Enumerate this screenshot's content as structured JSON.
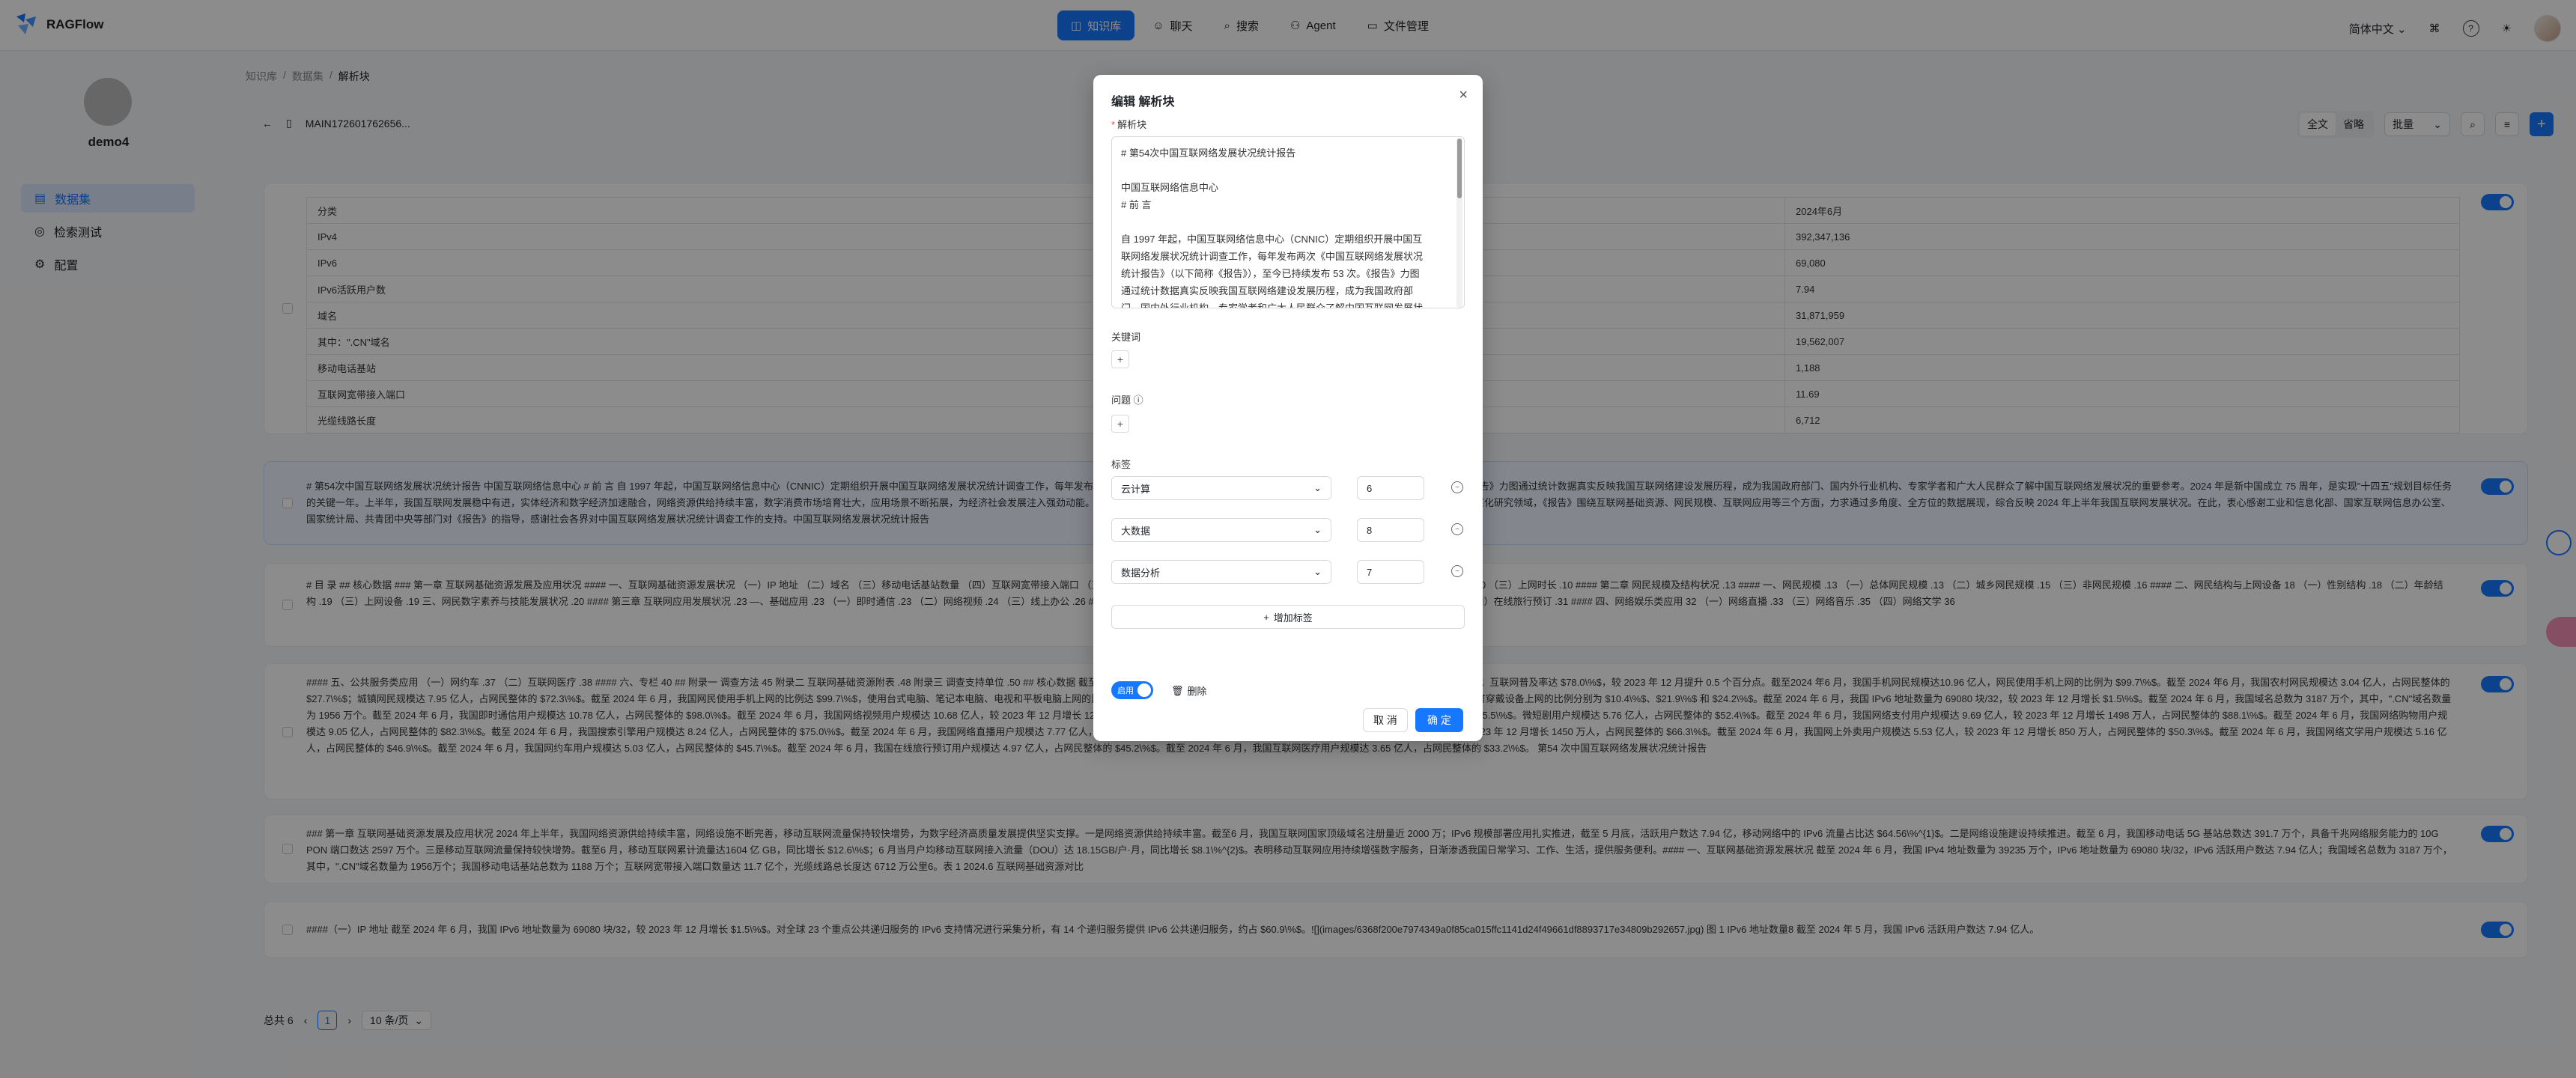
{
  "app": {
    "name": "RAGFlow"
  },
  "nav": {
    "items": [
      {
        "label": "知识库",
        "icon": "database-icon",
        "active": true
      },
      {
        "label": "聊天",
        "icon": "chat-icon",
        "active": false
      },
      {
        "label": "搜索",
        "icon": "search-icon",
        "active": false
      },
      {
        "label": "Agent",
        "icon": "agent-icon",
        "active": false
      },
      {
        "label": "文件管理",
        "icon": "folder-icon",
        "active": false
      }
    ],
    "language": "简体中文"
  },
  "sidebar": {
    "kb_name": "demo4",
    "items": [
      {
        "label": "数据集",
        "icon": "dataset-icon",
        "active": true
      },
      {
        "label": "检索测试",
        "icon": "retrieval-icon",
        "active": false
      },
      {
        "label": "配置",
        "icon": "gear-icon",
        "active": false
      }
    ]
  },
  "breadcrumb": [
    "知识库",
    "数据集",
    "解析块"
  ],
  "file": {
    "name": "MAIN172601762656..."
  },
  "toolbar": {
    "view_full": "全文",
    "view_brief": "省略",
    "batch": "批量"
  },
  "table": {
    "rows": [
      [
        "分类",
        "2024年6月"
      ],
      [
        "IPv4",
        "392,347,136"
      ],
      [
        "IPv6",
        "69,080"
      ],
      [
        "IPv6活跃用户数",
        "7.94"
      ],
      [
        "域名",
        "31,871,959"
      ],
      [
        "其中：\".CN\"域名",
        "19,562,007"
      ],
      [
        "移动电话基站",
        "1,188"
      ],
      [
        "互联网宽带接入端口",
        "11.69"
      ],
      [
        "光缆线路长度",
        "6,712"
      ]
    ]
  },
  "chunks": [
    "# 第54次中国互联网络发展状况统计报告 中国互联网络信息中心 # 前 言 自 1997 年起，中国互联网络信息中心（CNNIC）定期组织开展中国互联网络发展状况统计调查工作，每年发布两次《中国互联网络发展状况统计报告》（以下简称《报告》），至今已持续发布 53 次。《报告》力图通过统计数据真实反映我国互联网络建设发展历程，成为我国政府部门、国内外行业机构、专家学者和广大人民群众了解中国互联网络发展状况的重要参考。2024 年是新中国成立 75 周年，是实现\"十四五\"规划目标任务的关键一年。上半年，我国互联网发展稳中有进，实体经济和数字经济加速融合，网络资源供给持续丰富，数字消费市场培育壮大，应用场景不断拓展，为经济社会发展注入强劲动能。我国互联网络发展状况统计调查工作持续推进我国互联网发展历程，不断扩大研究范围，深化研究领域，《报告》围绕互联网基础资源、网民规模、互联网应用等三个方面，力求通过多角度、全方位的数据展现，综合反映 2024 年上半年我国互联网发展状况。在此，衷心感谢工业和信息化部、国家互联网信息办公室、国家统计局、共青团中央等部门对《报告》的指导，感谢社会各界对中国互联网络发展状况统计调查工作的支持。中国互联网络发展状况统计报告",
    "# 目 录 ## 核心数据 ### 第一章 互联网基础资源发展及应用状况 #### 一、互联网基础资源发展状况 （一）IP 地址 （二）域名 （三）移动电话基站数量 （四）互联网宽带接入端口 （五）光缆线路长度 ..... 二、IPv6 发展状况 ..... （一）网址 .. 9 （二）移动互联网接入流量 10 （三）上网时长 .10 #### 第二章 网民规模及结构状况 .13 #### 一、网民规模 .13 （一）总体网民规模 .13 （二）城乡网民规模 .15 （三）非网民规模 .16 #### 二、网民结构与上网设备 18 （一）性别结构 .18 （二）年龄结构 .19 （三）上网设备 .19 三、网民数字素养与技能发展状况 .20 #### 第三章 互联网应用发展状况 .23 —、基础应用 .23 （一）即时通信 .23 （二）网络视频 .24 （三）线上办公 .26 #### 三、商务交易类应用 （一）网络支付 .27 （二）网络购物 .28 （三）网上外卖 .29 （四）在线旅行预订 .31 #### 四、网络娱乐类应用 32 （一）网络直播 .33 （三）网络音乐 .35 （四）网络文学 36",
    "#### 五、公共服务类应用 （一）网约车 .37 （二）互联网医疗 .38 #### 六、专栏 40 ## 附录一 调查方法 45 附录二 互联网基础资源附表 .48 附录三 调查支持单位 .50 ## 核心数据 截至 2024 年 6 月，我国网民规模近 11 亿人（10.9967 亿人），较 2023 年 12 月增长 742万人；互联网普及率达 $78.0\\%$，较 2023 年 12 月提升 0.5 个百分点。截至2024 年6 月，我国手机网民规模达10.96 亿人，网民使用手机上网的比例为 $99.7\\%$。截至 2024 年6 月，我国农村网民规模达 3.04 亿人，占网民整体的 $27.7\\%$；城镇网民规模达 7.95 亿人，占网民整体的 $72.3\\%$。截至 2024 年 6 月，我国网民使用手机上网的比例达 $99.7\\%$，使用台式电脑、笔记本电脑、电视和平板电脑上网的比例分别为 $32.4\\%$、$25.2\\%$ 和 $30.5\\%$；使用智能网联汽车、智能家居设备和个人可穿戴设备上网的比例分别为 $10.4\\%$、$21.9\\%$ 和 $24.2\\%$。截至 2024 年 6 月，我国 IPv6 地址数量为 69080 块/32，较 2023 年 12 月增长 $1.5\\%$。截至 2024 年 6 月，我国域名总数为 3187 万个，其中，\".CN\"域名数量为 1956 万个。截至 2024 年 6 月，我国即时通信用户规模达 10.78 亿人，占网民整体的 $98.0\\%$。截至 2024 年 6 月，我国网络视频用户规模达 10.68 亿人，较 2023 年 12 月增长 125 万人，占网民整体的 $97.1\\%$，其中，短视频用户规模达 10.50 亿人，占网民整体的 $95.5\\%$。微短剧用户规模达 5.76 亿人，占网民整体的 $52.4\\%$。截至 2024 年 6 月，我国网络支付用户规模达 9.69 亿人，较 2023 年 12 月增长 1498 万人，占网民整体的 $88.1\\%$。截至 2024 年 6 月，我国网络购物用户规模达 9.05 亿人，占网民整体的 $82.3\\%$。截至 2024 年 6 月，我国搜索引擎用户规模达 8.24 亿人，占网民整体的 $75.0\\%$。截至 2024 年 6 月，我国网络直播用户规模达 7.77 亿人，占网民整体的 $70.6\\%$。截至 2024 年 6 月，我国网络音乐用户规模达 7.29 亿人，较 2023 年 12 月增长 1450 万人，占网民整体的 $66.3\\%$。截至 2024 年 6 月，我国网上外卖用户规模达 5.53 亿人，较 2023 年 12 月增长 850 万人，占网民整体的 $50.3\\%$。截至 2024 年 6 月，我国网络文学用户规模达 5.16 亿人，占网民整体的 $46.9\\%$。截至 2024 年 6 月，我国网约车用户规模达 5.03 亿人，占网民整体的 $45.7\\%$。截至 2024 年 6 月，我国在线旅行预订用户规模达 4.97 亿人，占网民整体的 $45.2\\%$。截至 2024 年 6 月，我国互联网医疗用户规模达 3.65 亿人，占网民整体的 $33.2\\%$。 第54 次中国互联网络发展状况统计报告",
    "### 第一章 互联网基础资源发展及应用状况 2024 年上半年，我国网络资源供给持续丰富，网络设施不断完善，移动互联网流量保持较快增势，为数字经济高质量发展提供坚实支撑。一是网络资源供给持续丰富。截至6 月，我国互联网国家顶级域名注册量近 2000 万；IPv6 规模部署应用扎实推进，截至 5 月底，活跃用户数达 7.94 亿，移动网络中的 IPv6 流量占比达 $64.56\\%^{1}$。二是网络设施建设持续推进。截至 6 月，我国移动电话 5G 基站总数达 391.7 万个，具备千兆网络服务能力的 10G PON 端口数达 2597 万个。三是移动互联网流量保持较快增势。截至6 月，移动互联网累计流量达1604 亿 GB，同比增长 $12.6\\%$；6 月当月户均移动互联网接入流量（DOU）达 18.15GB/户·月，同比增长 $8.1\\%^{2}$。表明移动互联网应用持续增强数字服务，日渐渗透我国日常学习、工作、生活，提供服务便利。#### 一、互联网基础资源发展状况 截至 2024 年 6 月，我国 IPv4 地址数量为 39235 万个，IPv6 地址数量为 69080 块/32，IPv6 活跃用户数达 7.94 亿人；我国域名总数为 3187 万个，其中，\".CN\"域名数量为 1956万个；我国移动电话基站总数为 1188 万个；互联网宽带接入端口数量达 11.7 亿个，光缆线路总长度达 6712 万公里6。表 1 2024.6 互联网基础资源对比",
    "####（一）IP 地址 截至 2024 年 6 月，我国 IPv6 地址数量为 69080 块/32，较 2023 年 12 月增长 $1.5\\%$。对全球 23 个重点公共递归服务的 IPv6 支持情况进行采集分析，有 14 个递归服务提供 IPv6 公共递归服务，约占 $60.9\\%$。![](images/6368f200e7974349a0f85ca015ffc1141d24f49661df8893717e34809b292657.jpg) 图 1 IPv6 地址数量8 截至 2024 年 5 月，我国 IPv6 活跃用户数达 7.94 亿人。"
  ],
  "pager": {
    "total": "总共 6",
    "page": "1",
    "size": "10 条/页"
  },
  "modal": {
    "title": "编辑 解析块",
    "chunk_label": "解析块",
    "chunk_text": [
      "# 第54次中国互联网络发展状况统计报告",
      "",
      "中国互联网络信息中心",
      "# 前 言",
      "",
      "自 1997 年起，中国互联网络信息中心（CNNIC）定期组织开展中国互",
      "联网络发展状况统计调查工作，每年发布两次《中国互联网络发展状况",
      "统计报告》（以下简称《报告》），至今已持续发布 53 次。《报告》力图",
      "通过统计数据真实反映我国互联网络建设发展历程，成为我国政府部",
      "门、国内外行业机构、专家学者和广大人民群众了解中国互联网发展状"
    ],
    "keywords_label": "关键词",
    "questions_label": "问题",
    "tags_label": "标签",
    "tags": [
      {
        "name": "云计算",
        "value": "6"
      },
      {
        "name": "大数据",
        "value": "8"
      },
      {
        "name": "数据分析",
        "value": "7"
      }
    ],
    "add_tag": "增加标签",
    "enable_label": "启用",
    "delete_label": "删除",
    "cancel": "取 消",
    "ok": "确 定"
  }
}
